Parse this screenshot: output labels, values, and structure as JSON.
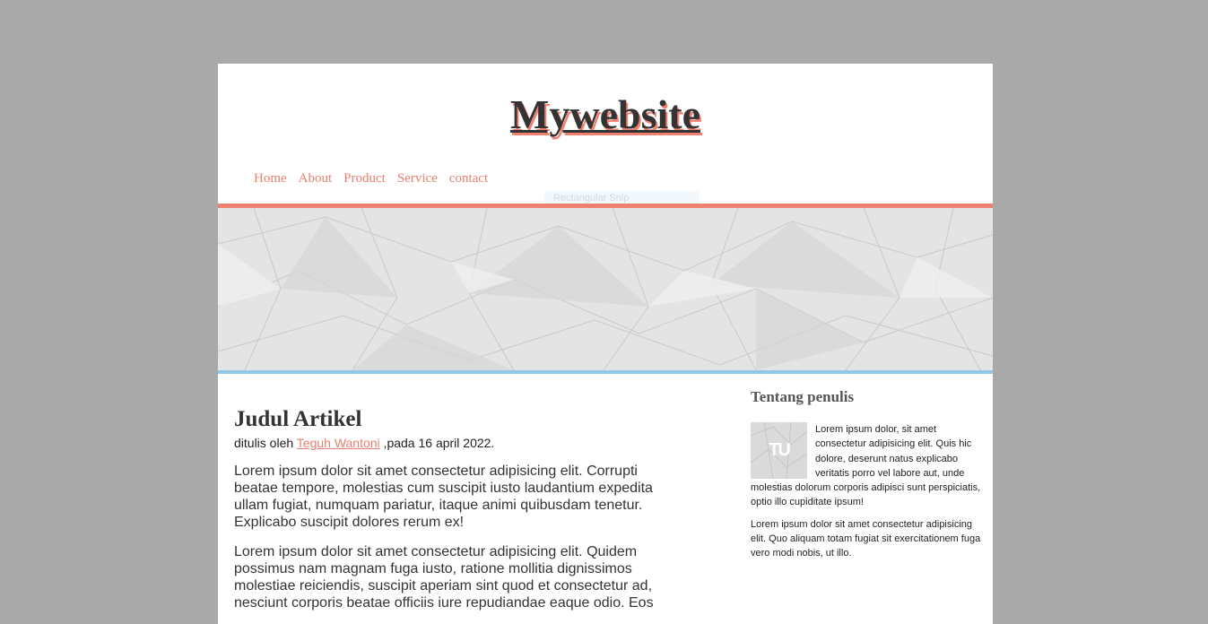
{
  "site": {
    "title": "Mywebsite"
  },
  "nav": {
    "items": [
      "Home",
      "About",
      "Product",
      "Service",
      "contact"
    ]
  },
  "tooltip": {
    "text": "Rectangular Snip"
  },
  "article": {
    "title": "Judul Artikel",
    "byline_prefix": "ditulis oleh ",
    "author": "Teguh Wantoni",
    "byline_suffix": " ,pada 16 april 2022.",
    "paragraphs": [
      "Lorem ipsum dolor sit amet consectetur adipisicing elit. Corrupti beatae tempore, molestias cum suscipit iusto laudantium expedita ullam fugiat, numquam pariatur, itaque animi quibusdam tenetur. Explicabo suscipit dolores rerum ex!",
      "Lorem ipsum dolor sit amet consectetur adipisicing elit. Quidem possimus nam magnam fuga iusto, ratione mollitia dignissimos molestiae reiciendis, suscipit aperiam sint quod et consectetur ad, nesciunt corporis beatae officiis iure repudiandae eaque odio. Eos"
    ]
  },
  "sidebar": {
    "heading": "Tentang penulis",
    "avatar_mark": "TU",
    "bio": "Lorem ipsum dolor, sit amet consectetur adipisicing elit. Quis hic dolore, deserunt natus explicabo veritatis porro vel labore aut, unde molestias dolorum corporis adipisci sunt perspiciatis, optio illo cupiditate ipsum!",
    "bio2": "Lorem ipsum dolor sit amet consectetur adipisicing elit. Quo aliquam totam fugiat sit exercitationem fuga vero modi nobis, ut illo."
  },
  "colors": {
    "background": "#a9a9a9",
    "accent": "#f08070",
    "link": "#e8806f",
    "divider_blue": "#8ec9ea"
  },
  "icons": {
    "hero": "crumpled-paper-texture",
    "avatar": "author-avatar"
  }
}
